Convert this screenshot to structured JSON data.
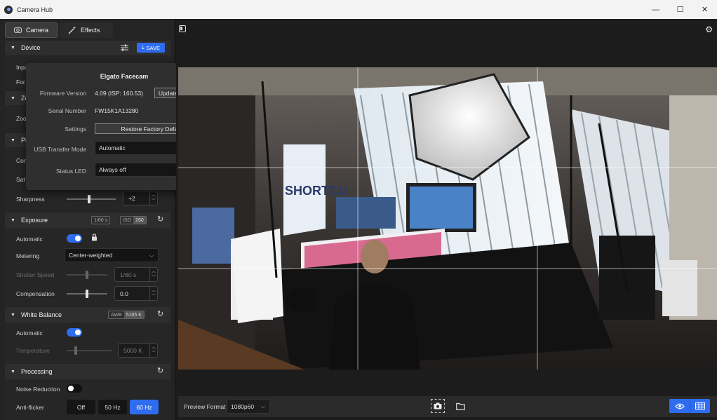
{
  "window": {
    "title": "Camera Hub",
    "minimize": "—",
    "maximize": "☐",
    "close": "✕"
  },
  "tabs": [
    {
      "label": "Camera"
    },
    {
      "label": "Effects"
    }
  ],
  "device": {
    "header": "Device",
    "save_label": "SAVE",
    "partial_labels": [
      "Inpu",
      "For"
    ]
  },
  "zoom": {
    "header_partial": "Zo",
    "row_partial": "Zoo"
  },
  "picture": {
    "header_partial": "Pi",
    "rows_partial": [
      "Con",
      "Sat"
    ],
    "sharpness_label": "Sharpness",
    "sharpness_value": "+2",
    "sharpness_level": 0.45
  },
  "exposure": {
    "header": "Exposure",
    "badge_shutter": "1/60 s",
    "badge_iso_label": "ISO",
    "badge_iso_value": "260",
    "automatic_label": "Automatic",
    "automatic_on": true,
    "metering_label": "Metering",
    "metering_value": "Center-weighted",
    "shutter_label": "Shutter Speed",
    "shutter_value": "1/60 s",
    "shutter_level": 0.5,
    "compensation_label": "Compensation",
    "compensation_value": "0.0",
    "compensation_level": 0.5
  },
  "white_balance": {
    "header": "White Balance",
    "badge_label": "AWB",
    "badge_value": "5105 K",
    "automatic_label": "Automatic",
    "automatic_on": true,
    "temperature_label": "Temperature",
    "temperature_value": "5000 K",
    "temperature_level": 0.2
  },
  "processing": {
    "header": "Processing",
    "noise_label": "Noise Reduction",
    "noise_on": false,
    "antiflicker_label": "Anti-flicker",
    "antiflicker_options": [
      "Off",
      "50 Hz",
      "60 Hz"
    ],
    "antiflicker_selected": "60 Hz"
  },
  "popover": {
    "title": "Elgato Facecam",
    "firmware_label": "Firmware Version",
    "firmware_value": "4.09 (ISP: 160.53)",
    "update_button": "Update Firmware...",
    "serial_label": "Serial Number",
    "serial_value": "FW15K1A13280",
    "settings_label": "Settings",
    "restore_button": "Restore Factory Defaults",
    "usb_label": "USB Transfer Mode",
    "usb_value": "Automatic",
    "led_label": "Status LED",
    "led_value": "Always off"
  },
  "preview": {
    "monitor_text": "SHORTCU",
    "format_label": "Preview Format",
    "format_value": "1080p60"
  },
  "colors": {
    "accent": "#2f6df0",
    "panel": "#242424",
    "header": "#2e2e2e"
  },
  "icons": [
    "camera-icon",
    "magic-wand-icon",
    "filter-settings-icon",
    "download-icon",
    "gear-icon",
    "panel-toggle-icon",
    "lock-icon",
    "reset-icon",
    "snapshot-icon",
    "folder-icon",
    "eye-icon",
    "grid-icon"
  ]
}
